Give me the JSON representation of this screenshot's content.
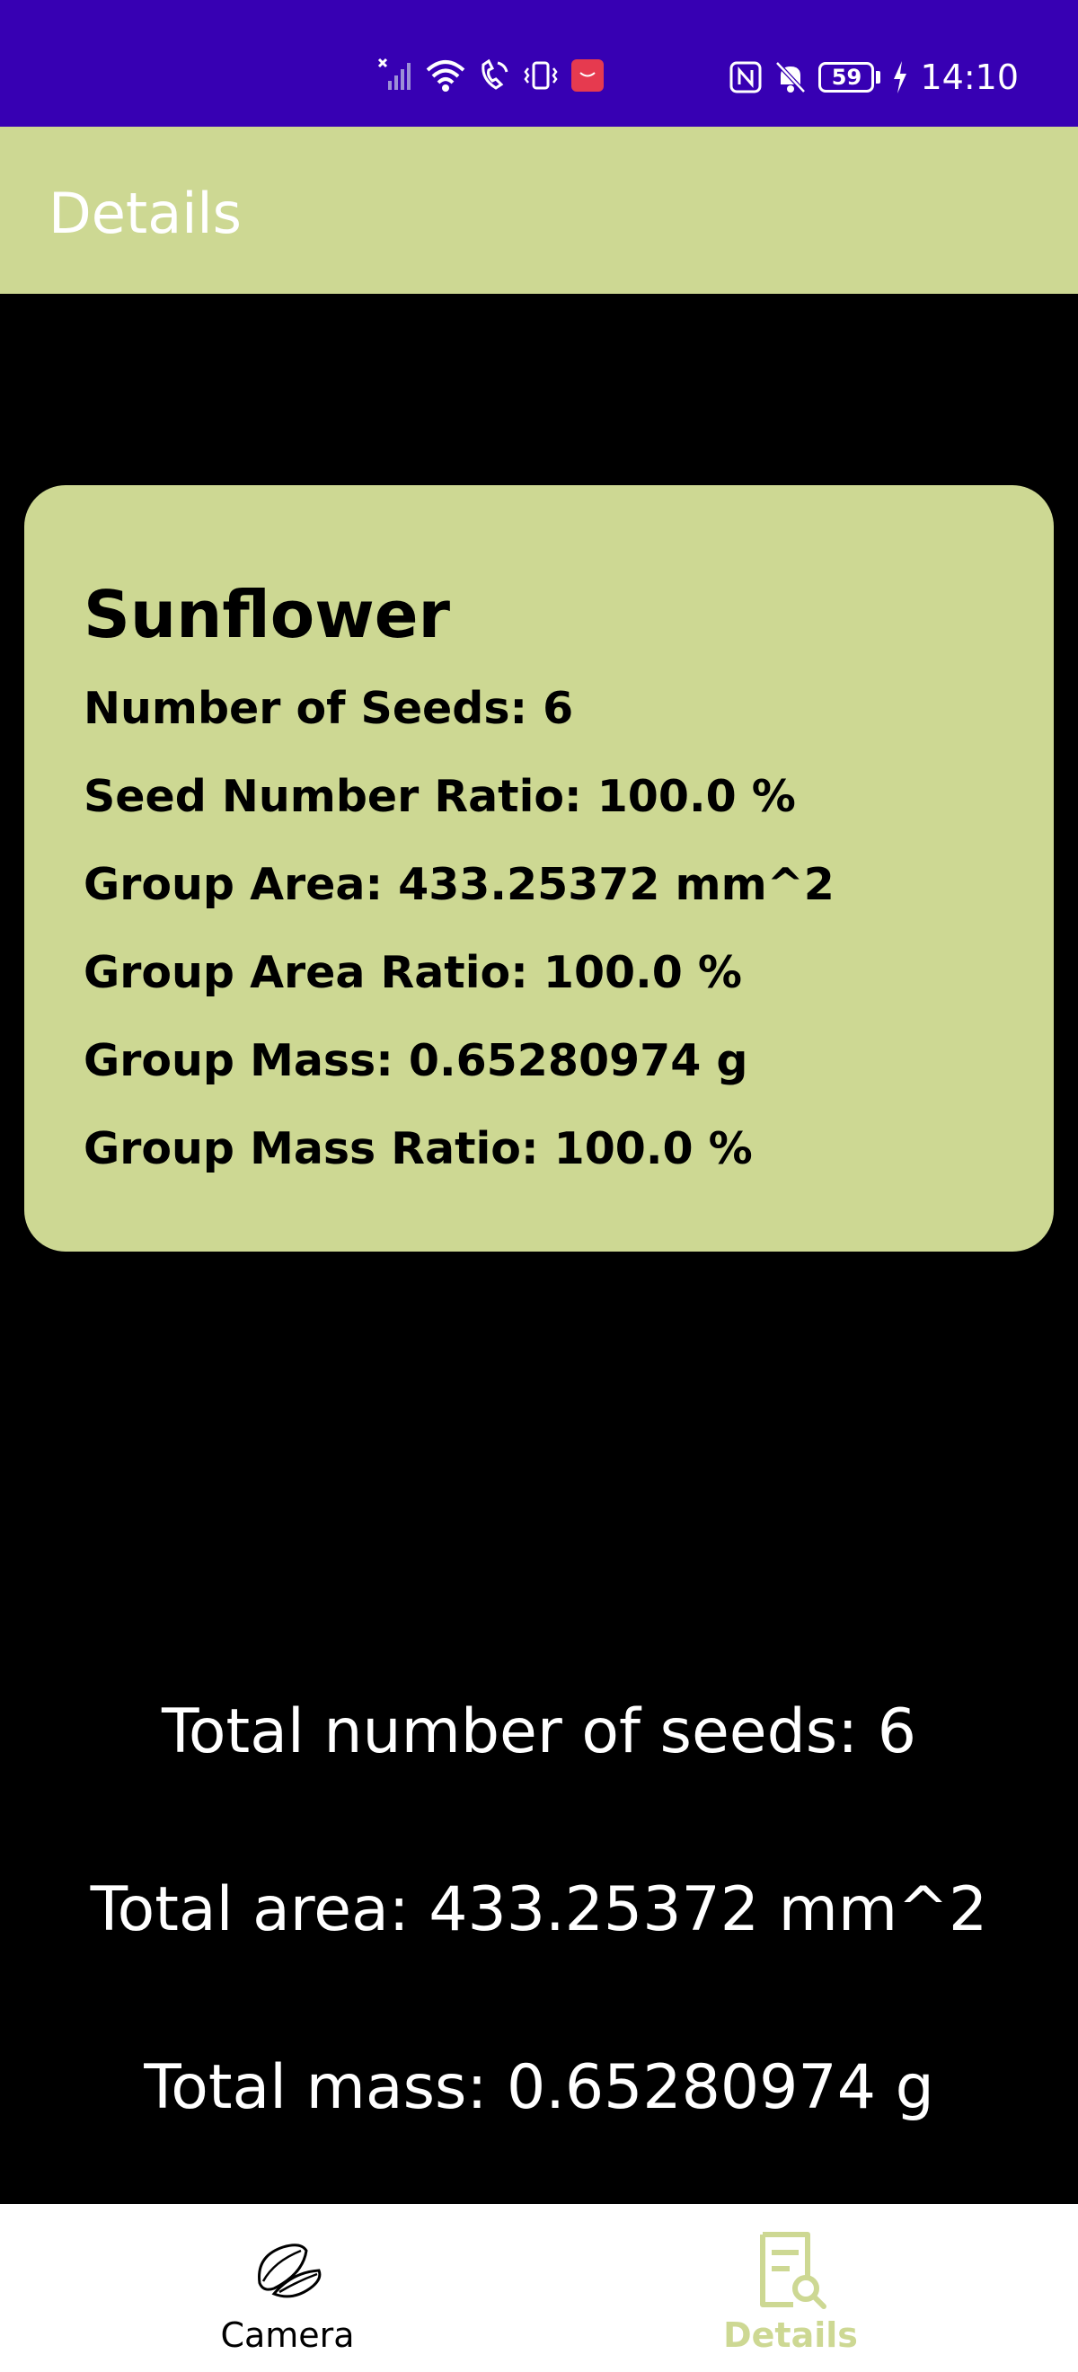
{
  "status_bar": {
    "time": "14:10",
    "battery": "59",
    "icons": [
      "no-sim-signal-icon",
      "wifi-icon",
      "wifi-calling-icon",
      "vibrate-icon",
      "huawei-app-icon",
      "nfc-icon",
      "bell-muted-icon",
      "battery-icon",
      "charging-bolt-icon"
    ],
    "color": "#3700b3"
  },
  "app_bar": {
    "title": "Details",
    "color": "#cdd893"
  },
  "card": {
    "title": "Sunflower",
    "lines": [
      "Number of Seeds: 6",
      "Seed Number Ratio: 100.0 %",
      "Group Area: 433.25372 mm^2",
      "Group Area Ratio: 100.0 %",
      "Group Mass: 0.65280974 g",
      "Group Mass Ratio: 100.0 %"
    ]
  },
  "totals": {
    "seeds": "Total number of seeds: 6",
    "area": "Total area: 433.25372 mm^2",
    "mass": "Total mass: 0.65280974 g"
  },
  "bottom_nav": {
    "items": [
      {
        "label": "Camera",
        "icon": "seeds-icon",
        "active": false
      },
      {
        "label": "Details",
        "icon": "document-search-icon",
        "active": true
      }
    ],
    "active_color": "#cdd893"
  }
}
